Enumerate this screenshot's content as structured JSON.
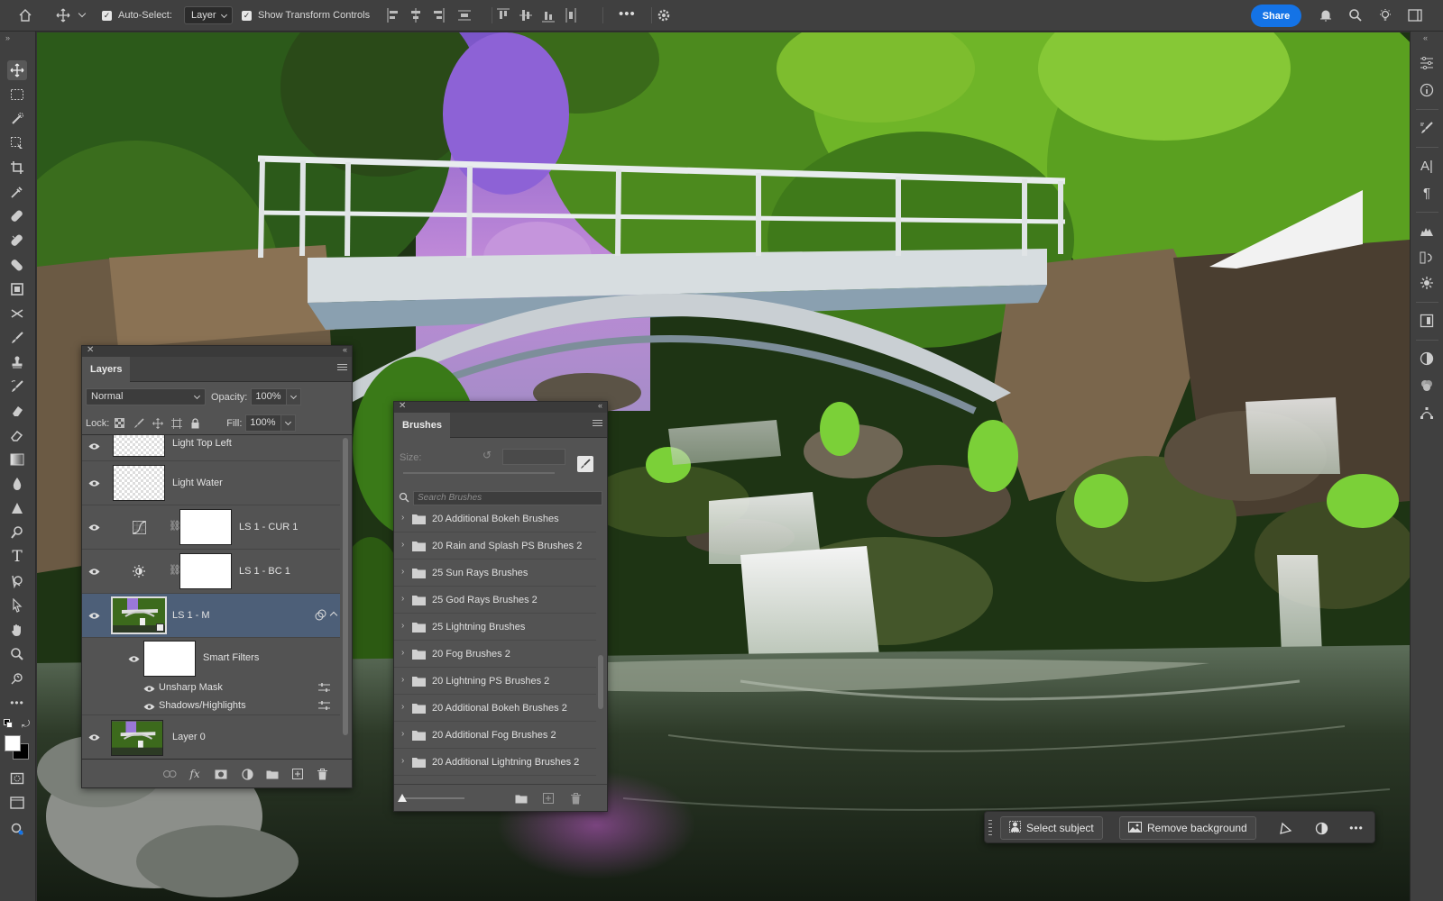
{
  "options_bar": {
    "auto_select_label": "Auto-Select:",
    "auto_select_value": "Layer",
    "show_transform_label": "Show Transform Controls",
    "share_label": "Share"
  },
  "layers_panel": {
    "tab_label": "Layers",
    "blend_mode": "Normal",
    "opacity_label": "Opacity:",
    "opacity_value": "100%",
    "lock_label": "Lock:",
    "fill_label": "Fill:",
    "fill_value": "100%",
    "layers": [
      {
        "name": "Light Top Left"
      },
      {
        "name": "Light Water"
      },
      {
        "name": "LS 1 - CUR 1"
      },
      {
        "name": "LS 1 - BC 1"
      },
      {
        "name": "LS 1 - M"
      },
      {
        "name": "Smart Filters"
      },
      {
        "name": "Unsharp Mask"
      },
      {
        "name": "Shadows/Highlights"
      },
      {
        "name": "Layer 0"
      }
    ],
    "fx_label": "fx"
  },
  "brushes_panel": {
    "tab_label": "Brushes",
    "size_label": "Size:",
    "search_placeholder": "Search Brushes",
    "items": [
      {
        "name": "20 Additional Bokeh Brushes"
      },
      {
        "name": "20 Rain and Splash PS Brushes 2"
      },
      {
        "name": "25 Sun Rays Brushes"
      },
      {
        "name": "25 God Rays Brushes 2"
      },
      {
        "name": "25 Lightning Brushes"
      },
      {
        "name": "20 Fog Brushes 2"
      },
      {
        "name": "20 Lightning PS Brushes 2"
      },
      {
        "name": "20 Additional Bokeh Brushes 2"
      },
      {
        "name": "20 Additional Fog Brushes 2"
      },
      {
        "name": "20 Additional Lightning Brushes 2"
      }
    ]
  },
  "task_bar": {
    "select_subject_label": "Select subject",
    "remove_background_label": "Remove background"
  },
  "colors": {
    "accent": "#1473e6",
    "selected_layer": "#4d5f78",
    "panel_bg": "#535353",
    "chrome_bg": "#404040"
  }
}
